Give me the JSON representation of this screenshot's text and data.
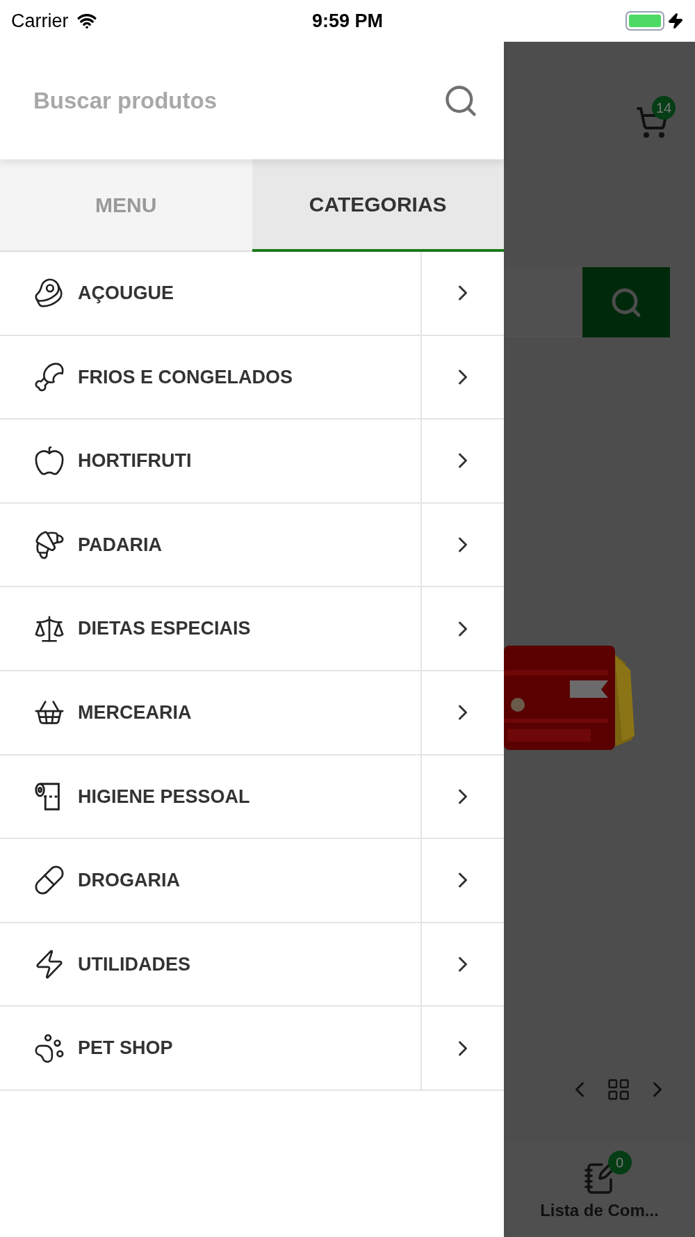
{
  "status_bar": {
    "carrier": "Carrier",
    "time": "9:59 PM"
  },
  "drawer": {
    "search": {
      "placeholder": "Buscar produtos"
    },
    "tabs": [
      {
        "label": "MENU",
        "selected": false
      },
      {
        "label": "CATEGORIAS",
        "selected": true
      }
    ],
    "categories": [
      {
        "label": "AÇOUGUE"
      },
      {
        "label": "FRIOS E CONGELADOS"
      },
      {
        "label": "HORTIFRUTI"
      },
      {
        "label": "PADARIA"
      },
      {
        "label": "DIETAS ESPECIAIS"
      },
      {
        "label": "MERCEARIA"
      },
      {
        "label": "HIGIENE PESSOAL"
      },
      {
        "label": "DROGARIA"
      },
      {
        "label": "UTILIDADES"
      },
      {
        "label": "PET SHOP"
      }
    ]
  },
  "background_page": {
    "cart_badge": "14",
    "list_badge": "0",
    "list_label": "Lista de Com..."
  }
}
